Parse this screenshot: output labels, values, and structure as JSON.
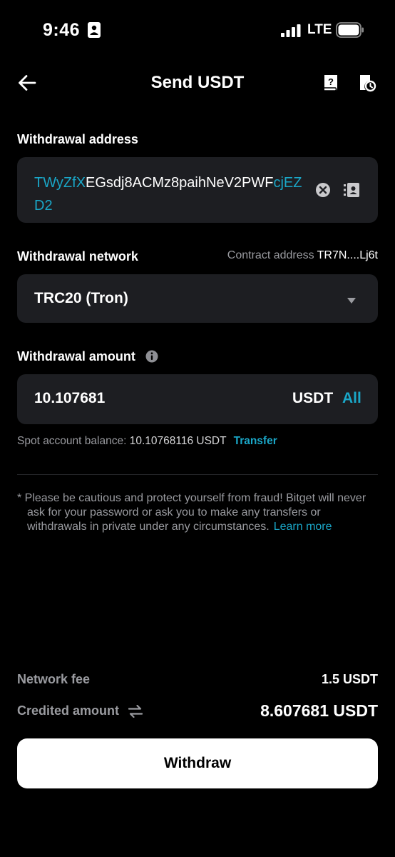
{
  "status_bar": {
    "time": "9:46",
    "network": "LTE",
    "icons": [
      "id-card-icon",
      "signal-icon",
      "battery-icon"
    ]
  },
  "header": {
    "title": "Send USDT",
    "icons": [
      "back-arrow-icon",
      "help-icon",
      "history-icon"
    ]
  },
  "address": {
    "label": "Withdrawal address",
    "value_highlight": "TWyZfX",
    "value_middle": "EGsdj8ACMz8paihNeV2PWF",
    "value_tail": "cjEZD2",
    "icons": [
      "clear-icon",
      "address-book-icon"
    ]
  },
  "network": {
    "label": "Withdrawal network",
    "contract_label": "Contract address",
    "contract_value": "TR7N....Lj6t",
    "selected": "TRC20 (Tron)",
    "icons": [
      "caret-down-icon"
    ]
  },
  "amount": {
    "label": "Withdrawal amount",
    "value": "10.107681",
    "unit": "USDT",
    "all_label": "All",
    "balance_label": "Spot account balance:",
    "balance_value": "10.10768116 USDT",
    "transfer_label": "Transfer",
    "icons": [
      "info-icon"
    ]
  },
  "notice": {
    "text": "* Please be cautious and protect yourself from fraud! Bitget will never ask for your password or ask you to make any transfers or withdrawals in private under any circumstances.",
    "link": "Learn more"
  },
  "summary": {
    "fee_label": "Network fee",
    "fee_value": "1.5 USDT",
    "credited_label": "Credited amount",
    "credited_value": "8.607681 USDT",
    "icons": [
      "swap-icon"
    ]
  },
  "action": {
    "withdraw_label": "Withdraw"
  },
  "colors": {
    "background": "#000000",
    "surface": "#1d1e22",
    "accent": "#1aa7c8",
    "muted": "#9a9ba0",
    "button": "#ffffff"
  }
}
